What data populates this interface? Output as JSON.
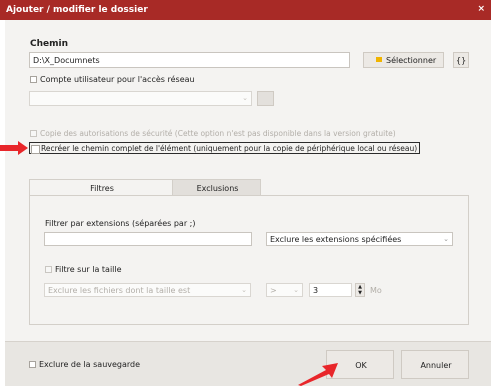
{
  "window": {
    "title": "Ajouter / modifier le dossier",
    "close_glyph": "×"
  },
  "path": {
    "label": "Chemin",
    "value": "D:\\X_Documnets",
    "select_button": "Sélectionner",
    "vars_button": "{}"
  },
  "network_account": {
    "label": "Compte utilisateur pour l'accès réseau"
  },
  "copy_security": {
    "label": "Copie des autorisations de sécurité (Cette option n'est pas disponible dans la version gratuite)"
  },
  "recreate_path": {
    "label": "Recréer le chemin complet de l'élément (uniquement pour la copie de périphérique local ou réseau)"
  },
  "tabs": [
    {
      "label": "Filtres"
    },
    {
      "label": "Exclusions"
    }
  ],
  "filters": {
    "extensions_label": "Filtrer par extensions (séparées par ;)",
    "extensions_value": "",
    "extensions_mode": "Exclure les extensions spécifiées",
    "size_filter_label": "Filtre sur la taille",
    "size_mode": "Exclure les fichiers dont la taille est",
    "size_operator": ">",
    "size_value": "3",
    "size_unit": "Mo"
  },
  "footer": {
    "exclude_backup_label": "Exclure de la sauvegarde",
    "ok_button": "OK",
    "cancel_button": "Annuler"
  },
  "colors": {
    "titlebar": "#a82a26",
    "annotation_arrow": "#e8262a",
    "folder_icon": "#f0b400"
  }
}
